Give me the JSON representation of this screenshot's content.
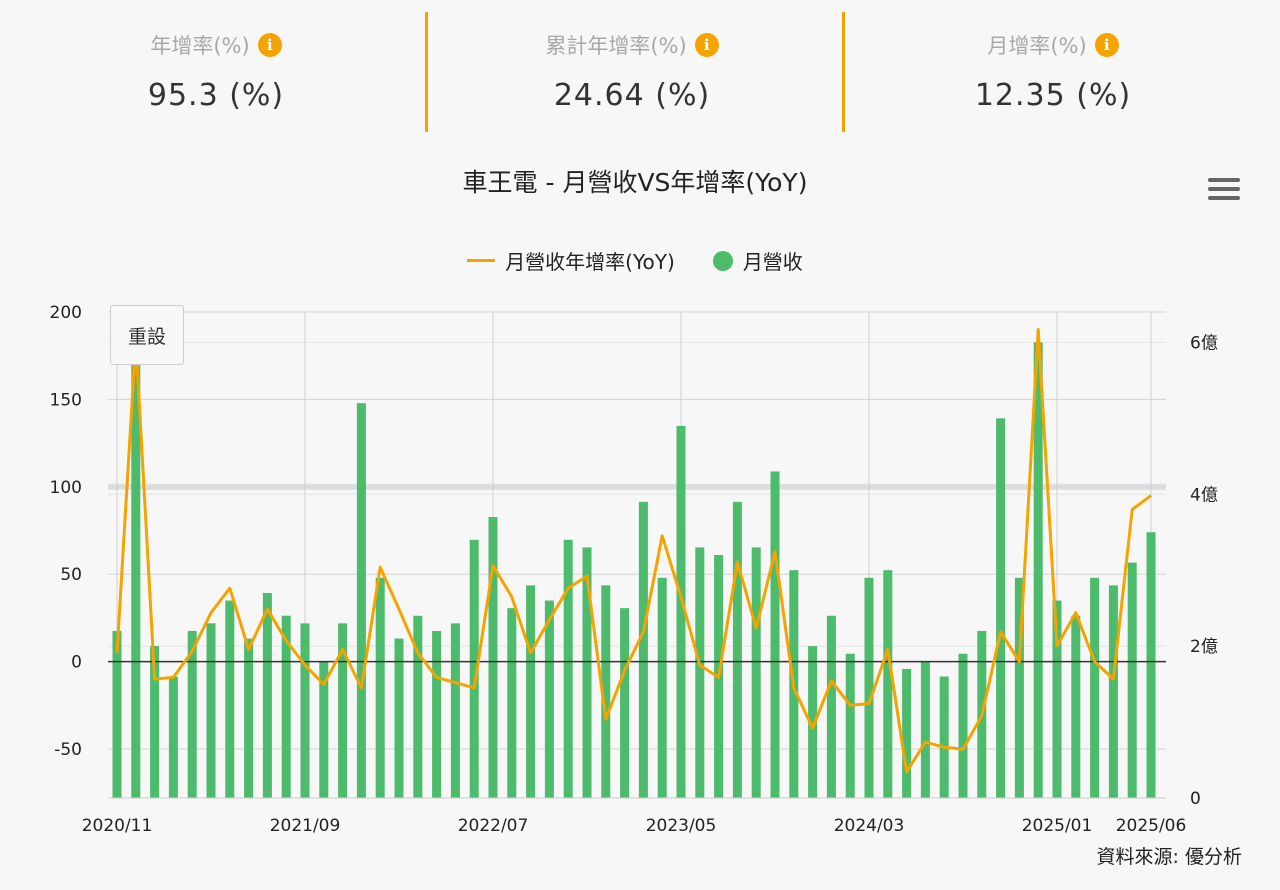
{
  "stats": [
    {
      "label": "年增率(%)",
      "value": "95.3 (%)"
    },
    {
      "label": "累計年增率(%)",
      "value": "24.64 (%)"
    },
    {
      "label": "月增率(%)",
      "value": "12.35 (%)"
    }
  ],
  "info_glyph": "i",
  "reset_label": "重設",
  "source_text": "資料來源: 優分析",
  "colors": {
    "accent": "#f5a300",
    "bar": "#4cbb6c",
    "background": "#f7f7f7"
  },
  "chart_data": {
    "type": "bar+line",
    "title": "車王電 - 月營收VS年增率(YoY)",
    "legend": [
      "月營收年增率(YoY)",
      "月營收"
    ],
    "legend_position": "top-center",
    "x_categories": [
      "2020/11",
      "2020/12",
      "2021/01",
      "2021/02",
      "2021/03",
      "2021/04",
      "2021/05",
      "2021/06",
      "2021/07",
      "2021/08",
      "2021/09",
      "2021/10",
      "2021/11",
      "2021/12",
      "2022/01",
      "2022/02",
      "2022/03",
      "2022/04",
      "2022/05",
      "2022/06",
      "2022/07",
      "2022/08",
      "2022/09",
      "2022/10",
      "2022/11",
      "2022/12",
      "2023/01",
      "2023/02",
      "2023/03",
      "2023/04",
      "2023/05",
      "2023/06",
      "2023/07",
      "2023/08",
      "2023/09",
      "2023/10",
      "2023/11",
      "2023/12",
      "2024/01",
      "2024/02",
      "2024/03",
      "2024/04",
      "2024/05",
      "2024/06",
      "2024/07",
      "2024/08",
      "2024/09",
      "2024/10",
      "2024/11",
      "2024/12",
      "2025/01",
      "2025/02",
      "2025/03",
      "2025/04",
      "2025/05",
      "2025/06"
    ],
    "x_tick_labels": [
      "2020/11",
      "2021/09",
      "2022/07",
      "2023/05",
      "2024/03",
      "2025/01",
      "2025/06"
    ],
    "left_axis": {
      "min": -78,
      "max": 200,
      "ticks": [
        -50,
        0,
        50,
        100,
        150,
        200
      ]
    },
    "right_axis": {
      "min": 0,
      "max": 6.4,
      "ticks": [
        0,
        2,
        4,
        6
      ],
      "tick_labels": [
        "0",
        "2億",
        "4億",
        "6億"
      ]
    },
    "series": [
      {
        "name": "月營收",
        "type": "bar",
        "axis": "right",
        "values": [
          2.2,
          6.0,
          2.0,
          1.6,
          2.2,
          2.3,
          2.6,
          2.1,
          2.7,
          2.4,
          2.3,
          1.8,
          2.3,
          5.2,
          2.9,
          2.1,
          2.4,
          2.2,
          2.3,
          3.4,
          3.7,
          2.5,
          2.8,
          2.6,
          3.4,
          3.3,
          2.8,
          2.5,
          3.9,
          2.9,
          4.9,
          3.3,
          3.2,
          3.9,
          3.3,
          4.3,
          3.0,
          2.0,
          2.4,
          1.9,
          2.9,
          3.0,
          1.7,
          1.8,
          1.6,
          1.9,
          2.2,
          5.0,
          2.9,
          6.0,
          2.6,
          2.4,
          2.9,
          2.8,
          3.1,
          3.5
        ]
      },
      {
        "name": "月營收年增率(YoY)",
        "type": "line",
        "axis": "left",
        "values": [
          5,
          184,
          -10,
          -9,
          6,
          28,
          42,
          7,
          30,
          12,
          -2,
          -13,
          7,
          -15,
          54,
          30,
          5,
          -9,
          -12,
          -15,
          55,
          37,
          5,
          24,
          42,
          49,
          -33,
          -5,
          17,
          72,
          37,
          -2,
          -9,
          57,
          19,
          63,
          -15,
          -38,
          -11,
          -25,
          -24,
          7,
          -63,
          -46,
          -49,
          -50,
          -31,
          17,
          0,
          190,
          9,
          28,
          0,
          -10,
          87,
          95
        ]
      }
    ]
  }
}
